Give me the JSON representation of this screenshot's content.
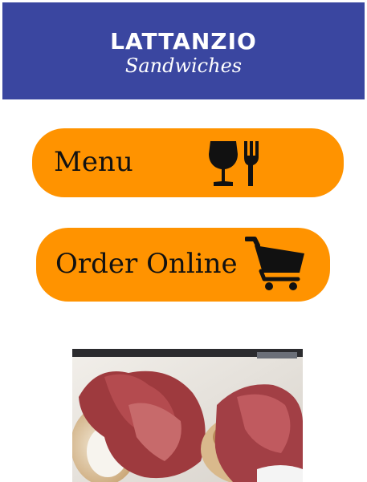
{
  "header": {
    "brand_name": "LATTANZIO",
    "tagline": "Sandwiches",
    "background_color": "#3a46a0"
  },
  "buttons": [
    {
      "label": "Menu",
      "icon": "wine-glass-fork-icon",
      "color": "#ff9300"
    },
    {
      "label": "Order Online",
      "icon": "shopping-cart-icon",
      "color": "#ff9300"
    }
  ],
  "photo": {
    "subject": "sandwich-photo"
  }
}
